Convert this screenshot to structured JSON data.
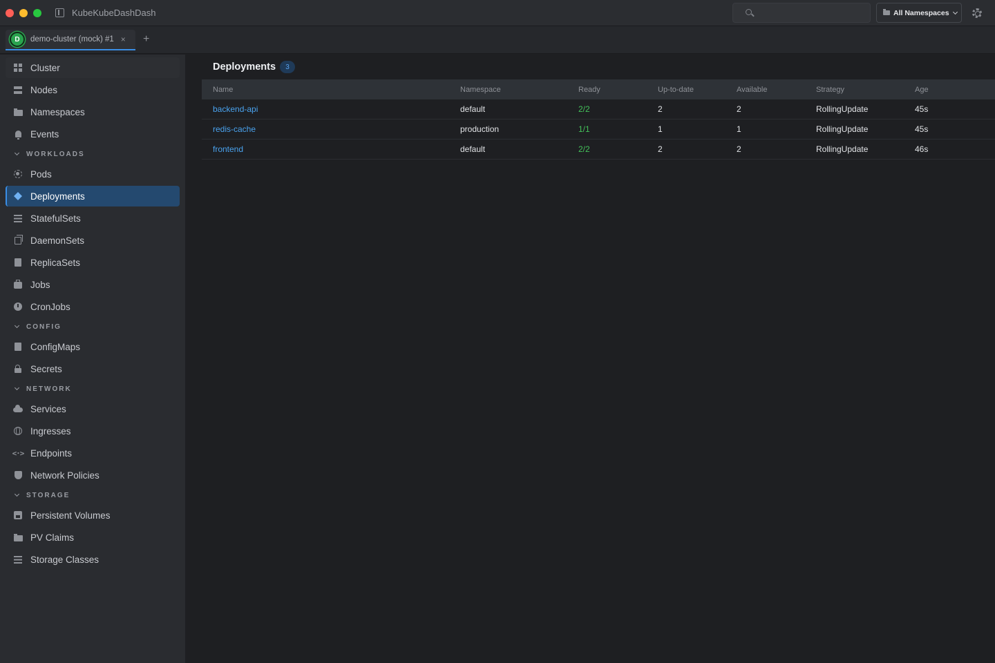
{
  "app": {
    "title": "KubeKubeDashDash",
    "namespace_selector": "All Namespaces"
  },
  "tabs": [
    {
      "avatar": "D",
      "label": "demo-cluster (mock) #1",
      "close": "×"
    }
  ],
  "tab_add": "+",
  "sidebar": {
    "top_items": [
      {
        "label": "Cluster",
        "icon": "dashboard-icon"
      },
      {
        "label": "Nodes",
        "icon": "server-icon"
      },
      {
        "label": "Namespaces",
        "icon": "folder-icon"
      },
      {
        "label": "Events",
        "icon": "bell-icon"
      }
    ],
    "sections": [
      {
        "title": "WORKLOADS",
        "items": [
          {
            "label": "Pods",
            "icon": "pod-icon"
          },
          {
            "label": "Deployments",
            "icon": "layers-icon",
            "active": true
          },
          {
            "label": "StatefulSets",
            "icon": "list-icon"
          },
          {
            "label": "DaemonSets",
            "icon": "copies-icon"
          },
          {
            "label": "ReplicaSets",
            "icon": "copy-icon"
          },
          {
            "label": "Jobs",
            "icon": "briefcase-icon"
          },
          {
            "label": "CronJobs",
            "icon": "clock-icon"
          }
        ]
      },
      {
        "title": "CONFIG",
        "items": [
          {
            "label": "ConfigMaps",
            "icon": "document-icon"
          },
          {
            "label": "Secrets",
            "icon": "lock-icon"
          }
        ]
      },
      {
        "title": "NETWORK",
        "items": [
          {
            "label": "Services",
            "icon": "cloud-icon"
          },
          {
            "label": "Ingresses",
            "icon": "globe-icon"
          },
          {
            "label": "Endpoints",
            "icon": "code-icon"
          },
          {
            "label": "Network Policies",
            "icon": "shield-icon"
          }
        ]
      },
      {
        "title": "STORAGE",
        "items": [
          {
            "label": "Persistent Volumes",
            "icon": "disk-icon"
          },
          {
            "label": "PV Claims",
            "icon": "folder-open-icon"
          },
          {
            "label": "Storage Classes",
            "icon": "list-icon"
          }
        ]
      }
    ]
  },
  "main": {
    "title": "Deployments",
    "count": "3",
    "columns": [
      "Name",
      "Namespace",
      "Ready",
      "Up-to-date",
      "Available",
      "Strategy",
      "Age"
    ],
    "rows": [
      {
        "name": "backend-api",
        "namespace": "default",
        "ready": "2/2",
        "up_to_date": "2",
        "available": "2",
        "strategy": "RollingUpdate",
        "age": "45s"
      },
      {
        "name": "redis-cache",
        "namespace": "production",
        "ready": "1/1",
        "up_to_date": "1",
        "available": "1",
        "strategy": "RollingUpdate",
        "age": "45s"
      },
      {
        "name": "frontend",
        "namespace": "default",
        "ready": "2/2",
        "up_to_date": "2",
        "available": "2",
        "strategy": "RollingUpdate",
        "age": "46s"
      }
    ]
  },
  "colors": {
    "accent": "#3a8ee6",
    "link": "#4aa3ef",
    "ready": "#44c05a",
    "cluster_avatar": "#2aa44f"
  }
}
